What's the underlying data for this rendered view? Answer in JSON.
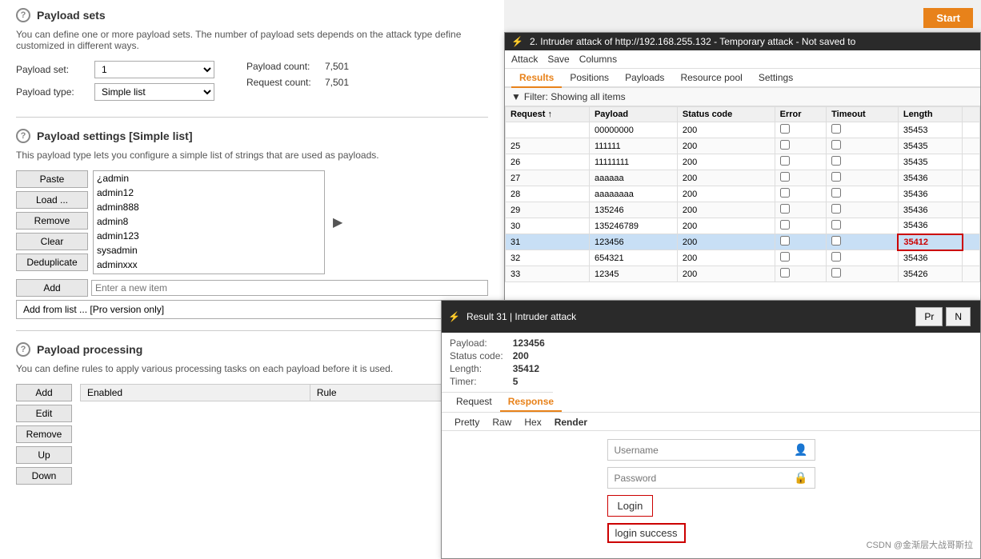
{
  "left_panel": {
    "payload_sets_title": "Payload sets",
    "payload_sets_desc": "You can define one or more payload sets. The number of payload sets depends on the attack type define customized in different ways.",
    "payload_set_label": "Payload set:",
    "payload_set_value": "1",
    "payload_count_label": "Payload count:",
    "payload_count_value": "7,501",
    "payload_type_label": "Payload type:",
    "payload_type_value": "Simple list",
    "request_count_label": "Request count:",
    "request_count_value": "7,501",
    "payload_settings_title": "Payload settings [Simple list]",
    "payload_settings_desc": "This payload type lets you configure a simple list of strings that are used as payloads.",
    "btn_paste": "Paste",
    "btn_load": "Load ...",
    "btn_remove": "Remove",
    "btn_clear": "Clear",
    "btn_deduplicate": "Deduplicate",
    "list_items": [
      {
        "text": "¿admin",
        "selected": false
      },
      {
        "text": "admin12",
        "selected": false
      },
      {
        "text": "admin888",
        "selected": false
      },
      {
        "text": "admin8",
        "selected": false
      },
      {
        "text": "admin123",
        "selected": false
      },
      {
        "text": "sysadmin",
        "selected": false
      },
      {
        "text": "adminxxx",
        "selected": false
      }
    ],
    "btn_add": "Add",
    "add_placeholder": "Enter a new item",
    "add_from_list_placeholder": "Add from list ... [Pro version only]",
    "payload_processing_title": "Payload processing",
    "payload_processing_desc": "You can define rules to apply various processing tasks on each payload before it is used.",
    "proc_btn_add": "Add",
    "proc_btn_edit": "Edit",
    "proc_btn_remove": "Remove",
    "proc_btn_up": "Up",
    "proc_btn_down": "Down",
    "proc_col_enabled": "Enabled",
    "proc_col_rule": "Rule"
  },
  "attack_window": {
    "title": "2. Intruder attack of http://192.168.255.132 - Temporary attack - Not saved to",
    "menu_attack": "Attack",
    "menu_save": "Save",
    "menu_columns": "Columns",
    "tabs": [
      "Results",
      "Positions",
      "Payloads",
      "Resource pool",
      "Settings"
    ],
    "active_tab": "Results",
    "filter_text": "Filter: Showing all items",
    "start_btn": "Start",
    "table_headers": [
      "Request",
      "Payload",
      "Status code",
      "Error",
      "Timeout",
      "Length",
      ""
    ],
    "rows": [
      {
        "request": "",
        "payload": "00000000",
        "status": "200",
        "error": false,
        "timeout": false,
        "length": "35453"
      },
      {
        "request": "25",
        "payload": "111111",
        "status": "200",
        "error": false,
        "timeout": false,
        "length": "35435"
      },
      {
        "request": "26",
        "payload": "11111111",
        "status": "200",
        "error": false,
        "timeout": false,
        "length": "35435"
      },
      {
        "request": "27",
        "payload": "aaaaaa",
        "status": "200",
        "error": false,
        "timeout": false,
        "length": "35436"
      },
      {
        "request": "28",
        "payload": "aaaaaaaa",
        "status": "200",
        "error": false,
        "timeout": false,
        "length": "35436"
      },
      {
        "request": "29",
        "payload": "135246",
        "status": "200",
        "error": false,
        "timeout": false,
        "length": "35436"
      },
      {
        "request": "30",
        "payload": "135246789",
        "status": "200",
        "error": false,
        "timeout": false,
        "length": "35436"
      },
      {
        "request": "31",
        "payload": "123456",
        "status": "200",
        "error": false,
        "timeout": false,
        "length": "35412",
        "highlighted": true
      },
      {
        "request": "32",
        "payload": "654321",
        "status": "200",
        "error": false,
        "timeout": false,
        "length": "35436"
      },
      {
        "request": "33",
        "payload": "12345",
        "status": "200",
        "error": false,
        "timeout": false,
        "length": "35426"
      }
    ]
  },
  "result_window": {
    "title": "Result 31 | Intruder attack",
    "payload_label": "Payload:",
    "payload_value": "123456",
    "status_label": "Status code:",
    "status_value": "200",
    "length_label": "Length:",
    "length_value": "35412",
    "timer_label": "Timer:",
    "timer_value": "5",
    "tabs_request": "Request",
    "tabs_response": "Response",
    "active_tab": "Response",
    "view_tabs": [
      "Pretty",
      "Raw",
      "Hex",
      "Render"
    ],
    "active_view": "Render",
    "username_placeholder": "Username",
    "password_placeholder": "Password",
    "login_btn": "Login",
    "login_success": "login success",
    "btn_pr": "Pr",
    "btn_n": "N"
  },
  "watermark": "CSDN @金渐层大战哥斯拉"
}
